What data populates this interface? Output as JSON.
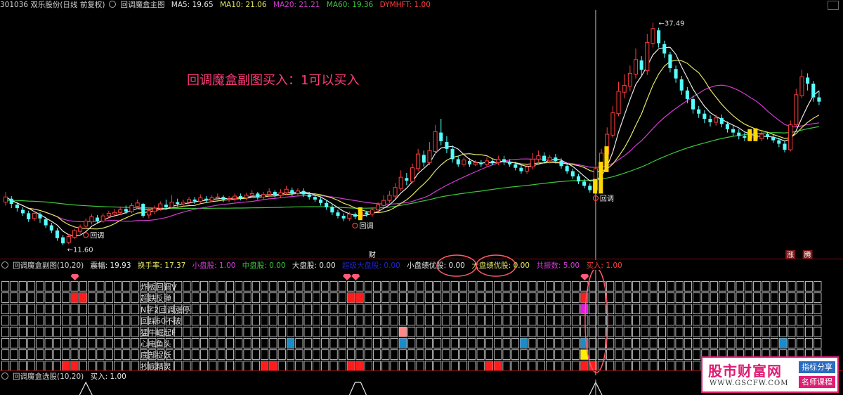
{
  "main_header": {
    "stock": "301036 双乐股份(日线 前复权)",
    "indicator": "回调魔盒主图",
    "ma5": "MA5: 19.65",
    "ma10": "MA10: 21.06",
    "ma20": "MA20: 21.21",
    "ma60": "MA60: 19.36",
    "dymhft": "DYMHFT: 1.00"
  },
  "annotation": "回调魔盒副图买入：1可以买入",
  "price_labels": {
    "high": "37.49",
    "low": "11.60"
  },
  "signal_label": "回调",
  "event_marks": {
    "cai": "财",
    "zhang": "涨",
    "teng": "腾"
  },
  "sub_header": {
    "name": "回调魔盒副图(10,20)",
    "amplitude": "震幅: 19.93",
    "turnover": "换手率: 17.37",
    "small": "小盘股: 1.00",
    "mid": "中盘股: 0.00",
    "large": "大盘股: 0.00",
    "hidden": "超级大盘股: 0.00",
    "small_q": "小盘绩优股: 0.00",
    "large_q": "大盘绩优股: 0.00",
    "resonance": "共振数: 5.00",
    "buy": "买入: 1.00"
  },
  "grid_rows": [
    "炸板回调V",
    "超跌反弹",
    "N字2回调涨停",
    "回踩60不破",
    "猛牛崛起F",
    "心电鱼头",
    "底部捉妖",
    "抄底精灵"
  ],
  "sel_header": {
    "name": "回调魔盒选股(10,20)",
    "buy": "买入: 1.00"
  },
  "colors": {
    "up": "#ff3c3c",
    "down": "#54ffff",
    "ma5": "#e8e8e8",
    "ma10": "#e6e664",
    "ma20": "#d23cd2",
    "ma60": "#3cc83c",
    "signal": "#ffd700",
    "annot": "#ff3c78"
  },
  "logo": {
    "name": "股市财富网",
    "url": "WWW.GSCFW.COM",
    "tag1": "指标分享",
    "tag2": "名师课程"
  },
  "chart_data": {
    "type": "candlestick",
    "title": "301036 双乐股份(日线 前复权)",
    "y_range": [
      11.0,
      38.5
    ],
    "candles": [
      [
        16.6,
        17.2,
        17.8,
        16.2
      ],
      [
        17.0,
        16.4,
        17.3,
        15.9
      ],
      [
        16.3,
        15.9,
        16.6,
        15.5
      ],
      [
        15.7,
        15.3,
        16.0,
        15.0
      ],
      [
        15.3,
        14.6,
        15.6,
        14.3
      ],
      [
        14.7,
        15.3,
        15.6,
        14.4
      ],
      [
        15.2,
        14.7,
        15.4,
        14.2
      ],
      [
        14.6,
        13.9,
        14.9,
        13.6
      ],
      [
        13.9,
        13.3,
        14.2,
        13.0
      ],
      [
        13.3,
        12.4,
        13.6,
        12.1
      ],
      [
        12.5,
        11.8,
        12.8,
        11.6
      ],
      [
        11.9,
        12.6,
        12.9,
        11.7
      ],
      [
        12.5,
        13.3,
        13.5,
        12.3
      ],
      [
        13.2,
        13.7,
        14.0,
        12.9
      ],
      [
        13.8,
        14.4,
        14.7,
        13.5
      ],
      [
        14.3,
        14.9,
        15.2,
        14.0
      ],
      [
        14.8,
        14.4,
        15.1,
        14.1
      ],
      [
        14.4,
        15.0,
        15.3,
        14.2
      ],
      [
        15.0,
        15.3,
        15.6,
        14.7
      ],
      [
        15.2,
        15.4,
        15.8,
        14.9
      ],
      [
        15.4,
        15.7,
        16.1,
        15.1
      ],
      [
        15.8,
        15.5,
        16.2,
        15.2
      ],
      [
        15.5,
        16.2,
        16.5,
        15.3
      ],
      [
        16.1,
        16.5,
        16.9,
        15.8
      ],
      [
        16.4,
        15.0,
        16.5,
        14.8
      ],
      [
        15.1,
        15.6,
        15.9,
        14.7
      ],
      [
        15.5,
        15.9,
        16.2,
        15.2
      ],
      [
        15.9,
        16.4,
        16.7,
        15.6
      ],
      [
        16.3,
        16.0,
        16.9,
        15.7
      ],
      [
        16.0,
        16.6,
        17.4,
        15.8
      ],
      [
        16.6,
        16.4,
        17.0,
        16.1
      ],
      [
        16.4,
        16.6,
        16.9,
        16.1
      ],
      [
        16.6,
        16.9,
        17.2,
        16.3
      ],
      [
        16.9,
        16.7,
        17.2,
        16.4
      ],
      [
        16.7,
        17.1,
        17.5,
        16.5
      ],
      [
        17.0,
        16.8,
        17.3,
        16.5
      ],
      [
        16.8,
        17.1,
        17.4,
        16.6
      ],
      [
        17.1,
        17.2,
        17.6,
        16.8
      ],
      [
        17.2,
        16.9,
        17.4,
        16.6
      ],
      [
        16.9,
        17.0,
        17.3,
        16.6
      ],
      [
        17.0,
        17.3,
        17.6,
        16.7
      ],
      [
        17.3,
        17.1,
        17.6,
        16.8
      ],
      [
        17.1,
        17.4,
        17.7,
        16.8
      ],
      [
        17.4,
        17.6,
        18.0,
        17.1
      ],
      [
        17.6,
        17.2,
        17.8,
        16.9
      ],
      [
        17.2,
        17.5,
        17.8,
        16.9
      ],
      [
        17.5,
        17.8,
        18.2,
        17.2
      ],
      [
        17.8,
        17.4,
        18.0,
        17.1
      ],
      [
        17.4,
        17.7,
        18.1,
        17.1
      ],
      [
        17.7,
        18.1,
        18.5,
        17.4
      ],
      [
        18.0,
        17.6,
        18.3,
        17.3
      ],
      [
        17.6,
        17.9,
        18.2,
        17.3
      ],
      [
        17.9,
        17.5,
        18.2,
        17.2
      ],
      [
        17.5,
        17.2,
        17.8,
        16.9
      ],
      [
        17.2,
        16.9,
        17.5,
        16.6
      ],
      [
        16.9,
        16.5,
        17.2,
        16.2
      ],
      [
        16.5,
        16.0,
        16.8,
        15.7
      ],
      [
        16.0,
        15.4,
        16.3,
        15.1
      ],
      [
        15.4,
        15.0,
        15.7,
        14.7
      ],
      [
        15.0,
        14.7,
        15.3,
        14.4
      ],
      [
        14.7,
        15.2,
        15.5,
        14.4
      ],
      [
        15.2,
        14.9,
        15.4,
        14.6
      ],
      [
        14.9,
        15.4,
        15.7,
        14.6
      ],
      [
        15.4,
        15.2,
        15.6,
        14.9
      ],
      [
        15.2,
        15.7,
        16.0,
        14.9
      ],
      [
        15.7,
        16.3,
        16.6,
        15.4
      ],
      [
        16.2,
        16.8,
        17.4,
        16.0
      ],
      [
        16.8,
        17.4,
        17.9,
        16.5
      ],
      [
        17.3,
        18.3,
        18.8,
        17.0
      ],
      [
        18.2,
        19.5,
        20.3,
        17.9
      ],
      [
        19.4,
        19.1,
        20.0,
        18.6
      ],
      [
        19.0,
        20.6,
        21.1,
        18.8
      ],
      [
        20.5,
        22.2,
        22.8,
        20.2
      ],
      [
        22.1,
        21.2,
        22.6,
        20.7
      ],
      [
        21.2,
        22.6,
        23.6,
        20.9
      ],
      [
        22.5,
        24.8,
        25.6,
        22.2
      ],
      [
        24.7,
        23.7,
        26.3,
        23.2
      ],
      [
        23.6,
        22.8,
        24.3,
        22.3
      ],
      [
        22.8,
        21.6,
        23.2,
        21.2
      ],
      [
        21.6,
        21.0,
        22.0,
        20.7
      ],
      [
        21.0,
        21.5,
        21.8,
        20.7
      ],
      [
        21.4,
        21.0,
        21.7,
        20.7
      ],
      [
        21.0,
        21.2,
        21.5,
        20.8
      ],
      [
        21.2,
        21.0,
        21.5,
        20.7
      ],
      [
        21.0,
        21.4,
        21.8,
        20.7
      ],
      [
        21.4,
        21.2,
        21.6,
        20.9
      ],
      [
        21.2,
        21.6,
        22.0,
        20.9
      ],
      [
        21.6,
        21.3,
        22.0,
        20.9
      ],
      [
        21.3,
        21.0,
        21.6,
        20.7
      ],
      [
        21.0,
        20.6,
        21.3,
        20.3
      ],
      [
        20.6,
        20.2,
        20.9,
        19.9
      ],
      [
        20.2,
        20.7,
        21.0,
        19.9
      ],
      [
        20.7,
        21.6,
        22.3,
        20.4
      ],
      [
        21.6,
        22.0,
        22.6,
        21.3
      ],
      [
        22.0,
        21.4,
        22.4,
        21.1
      ],
      [
        21.4,
        21.8,
        22.1,
        21.1
      ],
      [
        21.8,
        21.4,
        22.2,
        21.1
      ],
      [
        21.4,
        20.8,
        21.7,
        20.5
      ],
      [
        20.8,
        20.2,
        21.1,
        19.9
      ],
      [
        20.2,
        19.6,
        20.5,
        19.3
      ],
      [
        19.6,
        19.0,
        19.9,
        18.7
      ],
      [
        19.0,
        18.5,
        19.3,
        18.2
      ],
      [
        18.5,
        18.0,
        18.8,
        17.7
      ],
      [
        18.0,
        20.5,
        21.0,
        17.8
      ],
      [
        20.5,
        22.3,
        22.8,
        20.3
      ],
      [
        22.2,
        24.5,
        25.3,
        22.0
      ],
      [
        24.4,
        27.0,
        27.8,
        24.1
      ],
      [
        26.9,
        29.5,
        30.6,
        26.6
      ],
      [
        29.4,
        30.2,
        31.5,
        28.7
      ],
      [
        30.1,
        31.6,
        32.5,
        29.5
      ],
      [
        31.5,
        33.2,
        34.5,
        31.0
      ],
      [
        33.1,
        32.0,
        33.6,
        31.2
      ],
      [
        31.9,
        35.2,
        36.2,
        31.4
      ],
      [
        35.1,
        36.8,
        37.49,
        34.6
      ],
      [
        36.6,
        35.1,
        36.9,
        34.6
      ],
      [
        35.0,
        33.9,
        35.4,
        33.4
      ],
      [
        33.8,
        32.2,
        34.1,
        31.7
      ],
      [
        32.1,
        31.0,
        32.5,
        30.5
      ],
      [
        30.9,
        29.6,
        31.3,
        29.1
      ],
      [
        29.6,
        28.6,
        30.0,
        28.1
      ],
      [
        28.6,
        27.4,
        29.0,
        26.9
      ],
      [
        27.4,
        26.9,
        27.8,
        26.4
      ],
      [
        26.9,
        26.3,
        27.3,
        25.8
      ],
      [
        26.3,
        25.9,
        26.7,
        25.4
      ],
      [
        25.9,
        26.4,
        26.8,
        25.5
      ],
      [
        26.4,
        25.7,
        26.8,
        25.3
      ],
      [
        25.7,
        25.1,
        26.0,
        24.7
      ],
      [
        25.1,
        24.7,
        25.5,
        24.3
      ],
      [
        24.7,
        24.3,
        25.1,
        23.9
      ],
      [
        24.3,
        24.1,
        24.7,
        23.7
      ],
      [
        24.1,
        24.4,
        24.8,
        23.8
      ],
      [
        24.4,
        24.0,
        24.7,
        23.7
      ],
      [
        24.0,
        24.5,
        24.9,
        23.7
      ],
      [
        24.5,
        24.2,
        24.8,
        23.9
      ],
      [
        24.2,
        23.8,
        24.5,
        23.5
      ],
      [
        23.8,
        23.4,
        24.1,
        23.0
      ],
      [
        23.4,
        22.7,
        23.7,
        22.4
      ],
      [
        22.7,
        25.6,
        26.1,
        22.5
      ],
      [
        25.6,
        29.1,
        29.8,
        25.4
      ],
      [
        29.0,
        31.2,
        32.0,
        28.7
      ],
      [
        31.1,
        30.4,
        31.6,
        29.6
      ],
      [
        30.4,
        28.8,
        30.7,
        28.3
      ],
      [
        28.8,
        28.3,
        29.6,
        27.9
      ]
    ],
    "signal_indices": [
      14,
      61,
      103
    ],
    "big_yellow_indices": [
      61,
      102,
      103,
      104,
      129,
      130
    ]
  }
}
